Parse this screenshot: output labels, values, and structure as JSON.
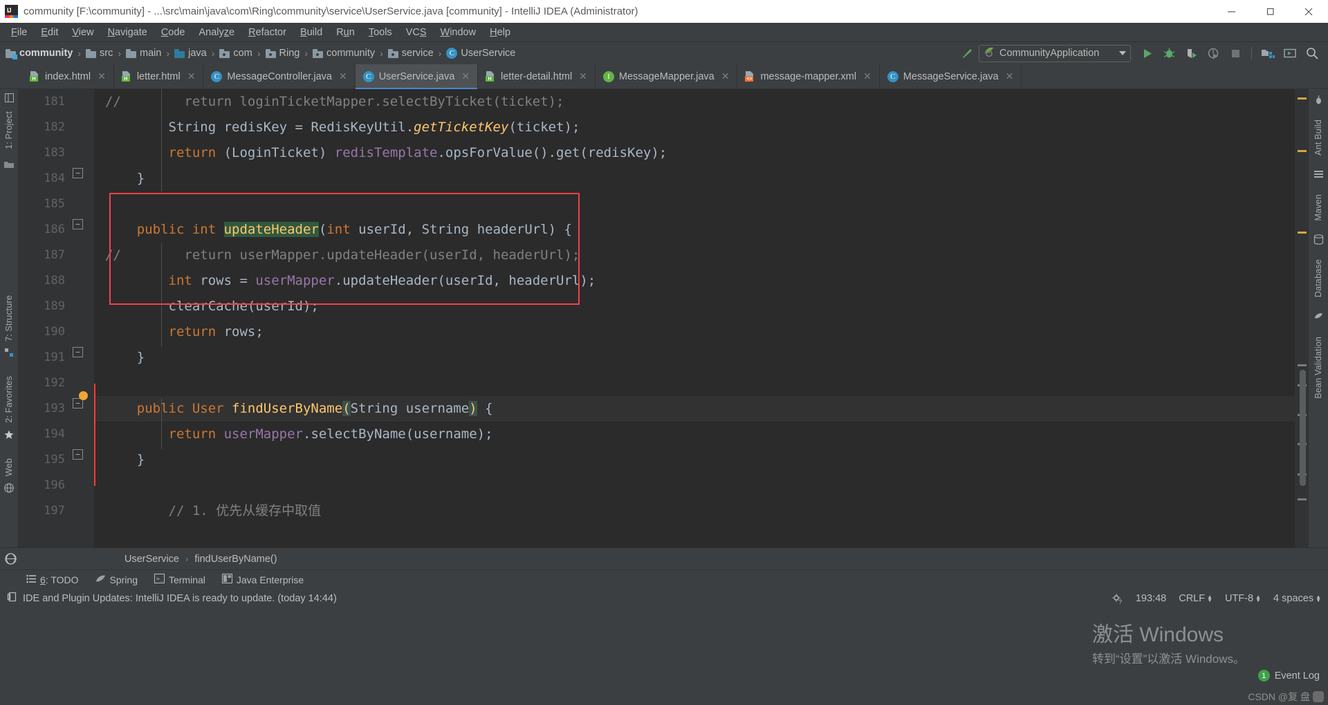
{
  "window": {
    "title": "community [F:\\community] - ...\\src\\main\\java\\com\\Ring\\community\\service\\UserService.java [community] - IntelliJ IDEA (Administrator)",
    "logo_text": "IJ",
    "controls": {
      "minimize": "minimize-icon",
      "maximize": "maximize-icon",
      "close": "close-icon"
    }
  },
  "menubar": {
    "items": [
      {
        "label": "File",
        "mnemonic": "F"
      },
      {
        "label": "Edit",
        "mnemonic": "E"
      },
      {
        "label": "View",
        "mnemonic": "V"
      },
      {
        "label": "Navigate",
        "mnemonic": "N"
      },
      {
        "label": "Code",
        "mnemonic": "C"
      },
      {
        "label": "Analyze",
        "mnemonic": "z"
      },
      {
        "label": "Refactor",
        "mnemonic": "R"
      },
      {
        "label": "Build",
        "mnemonic": "B"
      },
      {
        "label": "Run",
        "mnemonic": "u"
      },
      {
        "label": "Tools",
        "mnemonic": "T"
      },
      {
        "label": "VCS",
        "mnemonic": "S"
      },
      {
        "label": "Window",
        "mnemonic": "W"
      },
      {
        "label": "Help",
        "mnemonic": "H"
      }
    ]
  },
  "navbar": {
    "breadcrumbs": [
      {
        "label": "community",
        "icon": "module-folder-icon",
        "bold": true
      },
      {
        "label": "src",
        "icon": "folder-icon",
        "bold": false
      },
      {
        "label": "main",
        "icon": "folder-icon",
        "bold": false
      },
      {
        "label": "java",
        "icon": "source-root-folder-icon",
        "bold": false
      },
      {
        "label": "com",
        "icon": "package-folder-icon",
        "bold": false
      },
      {
        "label": "Ring",
        "icon": "package-folder-icon",
        "bold": false
      },
      {
        "label": "community",
        "icon": "package-folder-icon",
        "bold": false
      },
      {
        "label": "service",
        "icon": "package-folder-icon",
        "bold": false
      },
      {
        "label": "UserService",
        "icon": "java-class-icon",
        "bold": false
      }
    ],
    "separator": "›",
    "build_icon": "hammer-build-icon",
    "run_configuration": {
      "label": "CommunityApplication",
      "icon": "spring-boot-icon"
    },
    "actions": [
      {
        "name": "run-button",
        "icon": "run-triangle-icon",
        "color": "#59a869"
      },
      {
        "name": "debug-button",
        "icon": "debug-bug-icon",
        "color": "#59a869"
      },
      {
        "name": "run-with-coverage-button",
        "icon": "coverage-icon",
        "color": "#59a869"
      },
      {
        "name": "profile-button",
        "icon": "profiler-icon",
        "color": "#8d8d8d"
      },
      {
        "name": "stop-button",
        "icon": "stop-square-icon",
        "color": "#8d8d8d"
      },
      {
        "name": "project-structure-button",
        "icon": "project-structure-icon",
        "color": "#9aa7b0"
      },
      {
        "name": "terminal-button",
        "icon": "terminal-window-icon",
        "color": "#9aa7b0"
      },
      {
        "name": "search-everywhere-button",
        "icon": "search-icon",
        "color": "#bbbbbb"
      }
    ]
  },
  "tabs": [
    {
      "label": "index.html",
      "icon": "html-file-icon",
      "active": false
    },
    {
      "label": "letter.html",
      "icon": "html-file-icon",
      "active": false
    },
    {
      "label": "MessageController.java",
      "icon": "java-class-icon",
      "active": false
    },
    {
      "label": "UserService.java",
      "icon": "java-class-icon",
      "active": true
    },
    {
      "label": "letter-detail.html",
      "icon": "html-file-icon",
      "active": false
    },
    {
      "label": "MessageMapper.java",
      "icon": "java-interface-icon",
      "active": false
    },
    {
      "label": "message-mapper.xml",
      "icon": "xml-file-icon",
      "active": false
    },
    {
      "label": "MessageService.java",
      "icon": "java-class-icon",
      "active": false
    }
  ],
  "left_strip": [
    {
      "label": "1: Project",
      "icon": "project-tool-icon"
    },
    {
      "label": "2: Favorites",
      "icon": "favorites-star-icon"
    },
    {
      "label": "Web",
      "icon": "web-globe-icon"
    },
    {
      "label": "7: Structure",
      "icon": "structure-tool-icon"
    }
  ],
  "right_strip": [
    {
      "label": "Ant Build",
      "icon": "ant-build-icon"
    },
    {
      "label": "Maven",
      "icon": "maven-icon"
    },
    {
      "label": "Database",
      "icon": "database-icon"
    },
    {
      "label": "Bean Validation",
      "icon": "bean-validation-icon"
    }
  ],
  "editor": {
    "first_line_number": 181,
    "lines": [
      {
        "num": 181,
        "fold": null,
        "tokens": [
          {
            "t": "//",
            "c": "cmt",
            "indent": 0
          },
          {
            "t": "        return loginTicketMapper.selectByTicket(ticket);",
            "c": "cmt"
          }
        ]
      },
      {
        "num": 182,
        "fold": null,
        "tokens": [
          {
            "t": "        String",
            "c": "cls"
          },
          {
            "t": " redisKey ",
            "c": "txt"
          },
          {
            "t": "= ",
            "c": "txt"
          },
          {
            "t": "RedisKeyUtil.",
            "c": "cls"
          },
          {
            "t": "getTicketKey",
            "c": "ital"
          },
          {
            "t": "(ticket);",
            "c": "txt"
          }
        ]
      },
      {
        "num": 183,
        "fold": null,
        "tokens": [
          {
            "t": "        return",
            "c": "kw"
          },
          {
            "t": " (LoginTicket) ",
            "c": "cls"
          },
          {
            "t": "redisTemplate",
            "c": "fld"
          },
          {
            "t": ".opsForValue().get(redisKey);",
            "c": "txt"
          }
        ]
      },
      {
        "num": 184,
        "fold": "end",
        "tokens": [
          {
            "t": "    }",
            "c": "txt"
          }
        ]
      },
      {
        "num": 185,
        "fold": null,
        "tokens": []
      },
      {
        "num": 186,
        "fold": "start",
        "tokens": [
          {
            "t": "    public int ",
            "c": "kw"
          },
          {
            "t": "updateHeader",
            "c": "mth",
            "highlight": "search"
          },
          {
            "t": "(",
            "c": "txt"
          },
          {
            "t": "int",
            "c": "kw"
          },
          {
            "t": " userId, ",
            "c": "txt"
          },
          {
            "t": "String",
            "c": "cls"
          },
          {
            "t": " headerUrl) {",
            "c": "txt"
          }
        ]
      },
      {
        "num": 187,
        "fold": null,
        "tokens": [
          {
            "t": "//",
            "c": "cmt"
          },
          {
            "t": "        return userMapper.updateHeader(userId, headerUrl);",
            "c": "cmt"
          }
        ]
      },
      {
        "num": 188,
        "fold": null,
        "tokens": [
          {
            "t": "        int",
            "c": "kw"
          },
          {
            "t": " rows = ",
            "c": "txt"
          },
          {
            "t": "userMapper",
            "c": "fld"
          },
          {
            "t": ".updateHeader(userId, headerUrl);",
            "c": "txt"
          }
        ]
      },
      {
        "num": 189,
        "fold": null,
        "tokens": [
          {
            "t": "        clearCache(userId);",
            "c": "txt"
          }
        ]
      },
      {
        "num": 190,
        "fold": null,
        "tokens": [
          {
            "t": "        return",
            "c": "kw"
          },
          {
            "t": " rows;",
            "c": "txt"
          }
        ]
      },
      {
        "num": 191,
        "fold": "end",
        "tokens": [
          {
            "t": "    }",
            "c": "txt"
          }
        ]
      },
      {
        "num": 192,
        "fold": null,
        "tokens": []
      },
      {
        "num": 193,
        "fold": "start",
        "current": true,
        "bulb": true,
        "tokens": [
          {
            "t": "    public User ",
            "c": "kw"
          },
          {
            "t": "findUserByName",
            "c": "mth"
          },
          {
            "t": "(",
            "c": "hl-brace"
          },
          {
            "t": "String",
            "c": "cls"
          },
          {
            "t": " username",
            "c": "txt"
          },
          {
            "t": ")",
            "c": "hl-brace"
          },
          {
            "t": " {",
            "c": "txt"
          }
        ]
      },
      {
        "num": 194,
        "fold": null,
        "tokens": [
          {
            "t": "        return",
            "c": "kw"
          },
          {
            "t": " ",
            "c": "txt"
          },
          {
            "t": "userMapper",
            "c": "fld"
          },
          {
            "t": ".selectByName(username);",
            "c": "txt"
          }
        ]
      },
      {
        "num": 195,
        "fold": "end",
        "tokens": [
          {
            "t": "    }",
            "c": "txt"
          }
        ]
      },
      {
        "num": 196,
        "fold": null,
        "tokens": []
      },
      {
        "num": 197,
        "fold": null,
        "tokens": [
          {
            "t": "        // 1. 优先从缓存中取值",
            "c": "cmt"
          }
        ]
      }
    ],
    "annotation": {
      "type": "red-rectangle",
      "color": "#f4404b",
      "covers_lines": [
        192,
        195
      ]
    },
    "caret_position": "193:48"
  },
  "bottom_breadcrumb": {
    "items": [
      "UserService",
      "findUserByName()"
    ],
    "separator": "›",
    "icon": "web-globe-icon"
  },
  "tool_window_bar": [
    {
      "label": "6: TODO",
      "mnemonic": "6",
      "icon": "todo-list-icon"
    },
    {
      "label": "Spring",
      "icon": "spring-leaf-icon"
    },
    {
      "label": "Terminal",
      "icon": "terminal-icon"
    },
    {
      "label": "Java Enterprise",
      "icon": "java-enterprise-icon"
    }
  ],
  "status_bar": {
    "message": "IDE and Plugin Updates: IntelliJ IDEA is ready to update. (today 14:44)",
    "message_icon": "notification-icon",
    "background_tasks_icon": "background-process-icon",
    "caret": "193:48",
    "line_separator": "CRLF",
    "encoding": "UTF-8",
    "indent": "4 spaces",
    "event_log": {
      "label": "Event Log",
      "count": "1"
    }
  },
  "watermark": {
    "line1": "激活 Windows",
    "line2": "转到“设置”以激活 Windows。"
  },
  "csdn_watermark": "CSDN @复 盘",
  "colors": {
    "accent_blue": "#4a88c7",
    "annotation_red": "#f4404b",
    "green_run": "#59a869",
    "editor_bg": "#2b2b2b",
    "chrome_bg": "#3c3f41"
  }
}
